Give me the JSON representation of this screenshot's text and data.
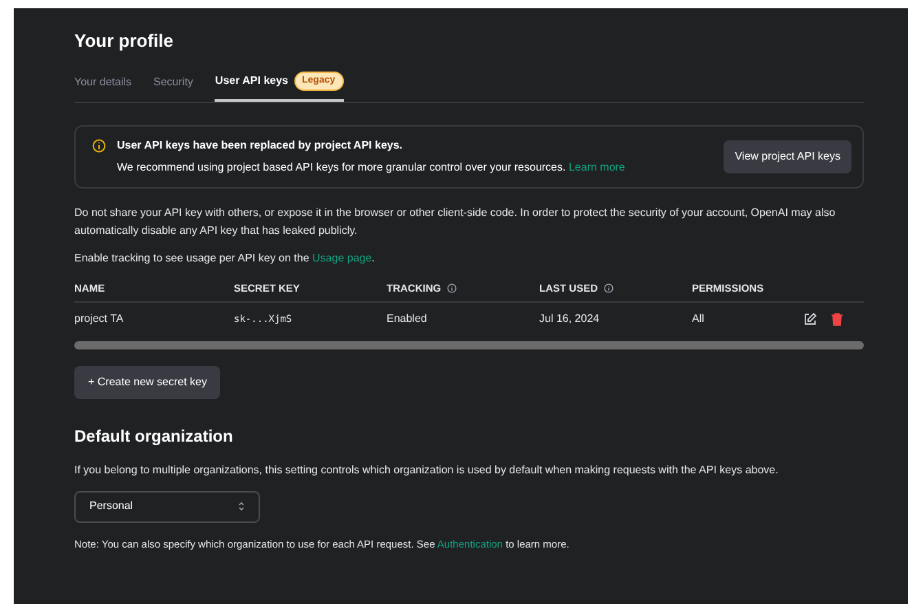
{
  "title": "Your profile",
  "tabs": [
    {
      "label": "Your details",
      "selected": false
    },
    {
      "label": "Security",
      "selected": false
    },
    {
      "label": "User API keys",
      "selected": true,
      "badge": "Legacy"
    }
  ],
  "notice": {
    "heading": "User API keys have been replaced by project API keys.",
    "body": "We recommend using project based API keys for more granular control over your resources.",
    "link": "Learn more",
    "button": "View project API keys"
  },
  "warning": "Do not share your API key with others, or expose it in the browser or other client-side code. In order to protect the security of your account, OpenAI may also automatically disable any API key that has leaked publicly.",
  "tracking_note": {
    "before": "Enable tracking to see usage per API key on the",
    "link": "Usage page",
    "after": "."
  },
  "table": {
    "columns": [
      {
        "label": "NAME",
        "info": false
      },
      {
        "label": "SECRET KEY",
        "info": false
      },
      {
        "label": "TRACKING",
        "info": true
      },
      {
        "label": "LAST USED",
        "info": true
      },
      {
        "label": "PERMISSIONS",
        "info": false
      }
    ],
    "rows": [
      {
        "name": "project TA",
        "secret_key": "sk-...XjmS",
        "tracking": "Enabled",
        "last_used": "Jul 16, 2024",
        "permissions": "All"
      }
    ]
  },
  "create_button": "+ Create new secret key",
  "default_org": {
    "heading": "Default organization",
    "description": "If you belong to multiple organizations, this setting controls which organization is used by default when making requests with the API keys above.",
    "select": "Personal",
    "note": {
      "before": "Note: You can also specify which organization to use for each API request. See",
      "link": "Authentication",
      "after": "to learn more."
    }
  }
}
